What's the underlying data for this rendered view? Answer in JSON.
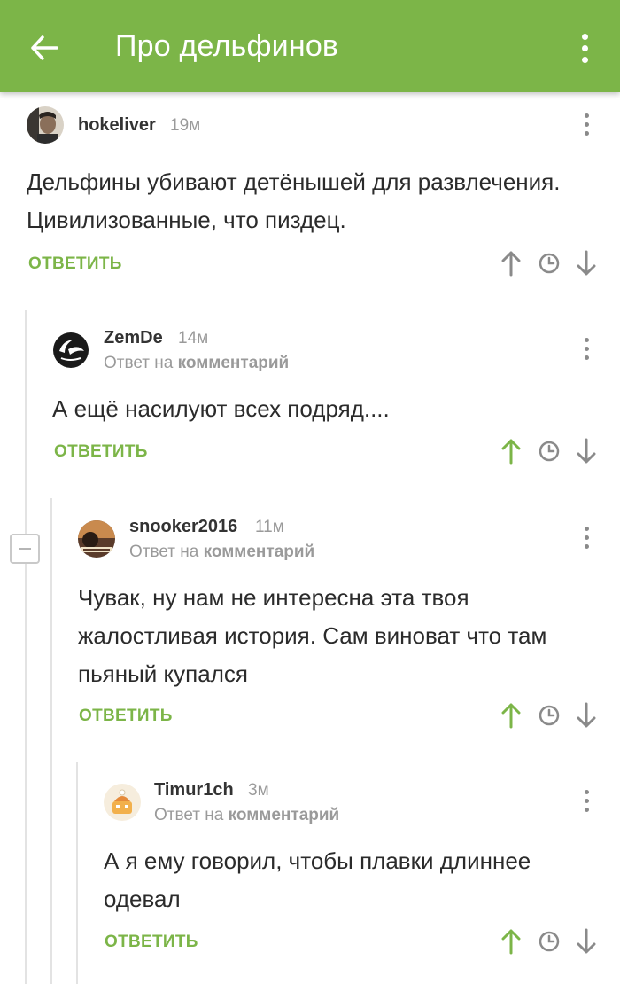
{
  "header": {
    "title": "Про дельфинов",
    "back_icon": "arrow-left-icon",
    "menu_icon": "more-vertical-icon"
  },
  "colors": {
    "accent": "#7cb548",
    "upvoted": "#7cb548",
    "neutral": "#8a8a8a"
  },
  "comments": [
    {
      "username": "hokeliver",
      "time": "19м",
      "reply_prefix": "",
      "reply_target": "",
      "text": "Дельфины убивают детёнышей для развлечения. Цивилизованные, что пиздец.",
      "reply_label": "ОТВЕТИТЬ",
      "upvoted": false
    },
    {
      "username": "ZemDe",
      "time": "14м",
      "reply_prefix": "Ответ на",
      "reply_target": "комментарий",
      "text": "А ещё насилуют всех подряд....",
      "reply_label": "ОТВЕТИТЬ",
      "upvoted": true
    },
    {
      "username": "snooker2016",
      "time": "11м",
      "reply_prefix": "Ответ на",
      "reply_target": "комментарий",
      "text": "Чувак, ну нам не интересна эта твоя жалостливая история. Сам виноват что там пьяный купался",
      "reply_label": "ОТВЕТИТЬ",
      "upvoted": true
    },
    {
      "username": "Timur1ch",
      "time": "3м",
      "reply_prefix": "Ответ на",
      "reply_target": "комментарий",
      "text": "А я ему говорил, чтобы плавки длиннее одевал",
      "reply_label": "ОТВЕТИТЬ",
      "upvoted": true
    }
  ]
}
